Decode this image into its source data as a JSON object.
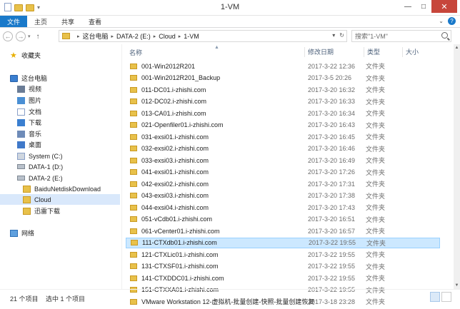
{
  "window": {
    "title": "1-VM",
    "controls": {
      "minimize": "—",
      "maximize": "□",
      "close": "✕"
    }
  },
  "ribbon": {
    "tabs": [
      "文件",
      "主页",
      "共享",
      "查看"
    ]
  },
  "navbar": {
    "back": "←",
    "forward": "→",
    "recent": "▾",
    "up": "↑",
    "crumbs": [
      "这台电脑",
      "DATA-2 (E:)",
      "Cloud",
      "1-VM"
    ],
    "search_placeholder": "搜索\"1-VM\""
  },
  "sidebar": {
    "items": [
      {
        "label": "收藏夹",
        "icon": "star-icon"
      },
      {
        "label": "这台电脑",
        "icon": "computer-icon"
      },
      {
        "label": "视频",
        "icon": "video-folder-icon"
      },
      {
        "label": "图片",
        "icon": "pictures-folder-icon"
      },
      {
        "label": "文档",
        "icon": "documents-folder-icon"
      },
      {
        "label": "下载",
        "icon": "downloads-folder-icon"
      },
      {
        "label": "音乐",
        "icon": "music-folder-icon"
      },
      {
        "label": "桌面",
        "icon": "desktop-folder-icon"
      },
      {
        "label": "System (C:)",
        "icon": "system-drive-icon"
      },
      {
        "label": "DATA-1 (D:)",
        "icon": "drive-icon"
      },
      {
        "label": "DATA-2 (E:)",
        "icon": "drive-icon"
      },
      {
        "label": "BaiduNetdiskDownload",
        "icon": "folder-icon"
      },
      {
        "label": "Cloud",
        "icon": "folder-icon"
      },
      {
        "label": "迅雷下载",
        "icon": "folder-icon"
      },
      {
        "label": "网络",
        "icon": "network-icon"
      }
    ]
  },
  "columns": {
    "name": "名称",
    "date": "修改日期",
    "type": "类型",
    "size": "大小"
  },
  "files": [
    {
      "name": "001-Win2012R201",
      "date": "2017-3-22 12:36",
      "type": "文件夹"
    },
    {
      "name": "001-Win2012R201_Backup",
      "date": "2017-3-5 20:26",
      "type": "文件夹"
    },
    {
      "name": "011-DC01.i-zhishi.com",
      "date": "2017-3-20 16:32",
      "type": "文件夹"
    },
    {
      "name": "012-DC02.i-zhishi.com",
      "date": "2017-3-20 16:33",
      "type": "文件夹"
    },
    {
      "name": "013-CA01.i-zhishi.com",
      "date": "2017-3-20 16:34",
      "type": "文件夹"
    },
    {
      "name": "021-Openfiler01.i-zhishi.com",
      "date": "2017-3-20 16:43",
      "type": "文件夹"
    },
    {
      "name": "031-exsi01.i-zhishi.com",
      "date": "2017-3-20 16:45",
      "type": "文件夹"
    },
    {
      "name": "032-exsi02.i-zhishi.com",
      "date": "2017-3-20 16:46",
      "type": "文件夹"
    },
    {
      "name": "033-exsi03.i-zhishi.com",
      "date": "2017-3-20 16:49",
      "type": "文件夹"
    },
    {
      "name": "041-exsi01.i-zhishi.com",
      "date": "2017-3-20 17:26",
      "type": "文件夹"
    },
    {
      "name": "042-exsi02.i-zhishi.com",
      "date": "2017-3-20 17:31",
      "type": "文件夹"
    },
    {
      "name": "043-exsi03.i-zhishi.com",
      "date": "2017-3-20 17:38",
      "type": "文件夹"
    },
    {
      "name": "044-exsi04.i-zhishi.com",
      "date": "2017-3-20 17:43",
      "type": "文件夹"
    },
    {
      "name": "051-vCdb01.i-zhishi.com",
      "date": "2017-3-20 16:51",
      "type": "文件夹"
    },
    {
      "name": "061-vCenter01.i-zhishi.com",
      "date": "2017-3-20 16:57",
      "type": "文件夹"
    },
    {
      "name": "111-CTXdb01.i-zhishi.com",
      "date": "2017-3-22 19:55",
      "type": "文件夹",
      "selected": true
    },
    {
      "name": "121-CTXLic01.i-zhishi.com",
      "date": "2017-3-22 19:55",
      "type": "文件夹"
    },
    {
      "name": "131-CTXSF01.i-zhishi.com",
      "date": "2017-3-22 19:55",
      "type": "文件夹"
    },
    {
      "name": "141-CTXDDC01.i-zhishi.com",
      "date": "2017-3-22 19:55",
      "type": "文件夹"
    },
    {
      "name": "151-CTXXA01.i-zhishi.com",
      "date": "2017-3-22 19:55",
      "type": "文件夹"
    },
    {
      "name": "VMware Workstation 12-虚拟机-批量创建-快照-批量创建恢复",
      "date": "2017-3-18 23:28",
      "type": "文件夹"
    }
  ],
  "status": {
    "count": "21 个项目",
    "selected": "选中 1 个项目"
  },
  "colors": {
    "accent": "#1979ca",
    "selection": "#cce8ff",
    "folder": "#e8c14a"
  }
}
